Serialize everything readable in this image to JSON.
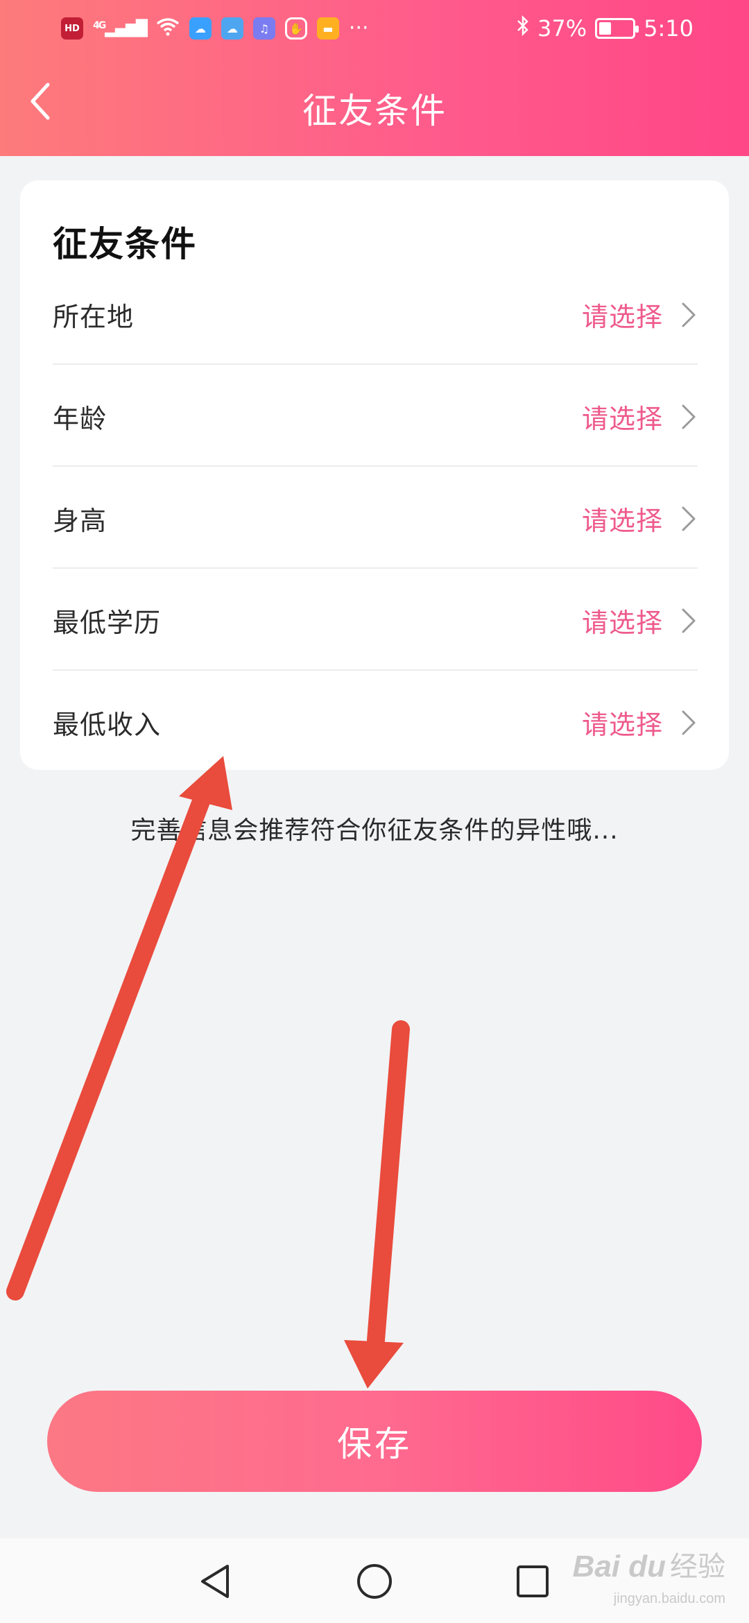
{
  "status_bar": {
    "hd_badge": "HD",
    "signal_text": "4G",
    "battery_percent": "37%",
    "battery_level": 0.37,
    "time": "5:10",
    "more": "···"
  },
  "header": {
    "title": "征友条件"
  },
  "card": {
    "title": "征友条件",
    "rows": [
      {
        "label": "所在地",
        "value": "请选择"
      },
      {
        "label": "年龄",
        "value": "请选择"
      },
      {
        "label": "身高",
        "value": "请选择"
      },
      {
        "label": "最低学历",
        "value": "请选择"
      },
      {
        "label": "最低收入",
        "value": "请选择"
      }
    ]
  },
  "hint": "完善信息会推荐符合你征友条件的异性哦...",
  "save_button": {
    "label": "保存"
  },
  "watermark": {
    "brand": "Bai du",
    "sub": "经验",
    "url": "jingyan.baidu.com"
  },
  "colors": {
    "header_start": "#fd7b7b",
    "header_end": "#ff4687",
    "value_text": "#ee5a8c",
    "annotation_arrow": "#e94b3c"
  }
}
